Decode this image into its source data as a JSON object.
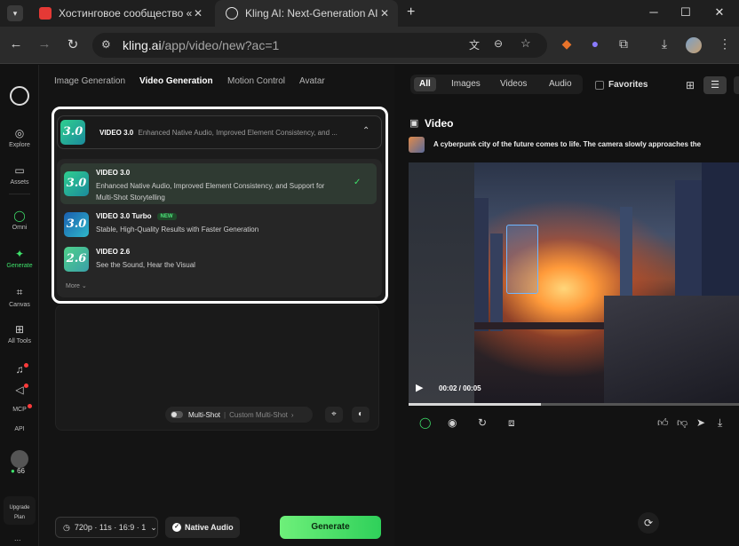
{
  "browser": {
    "tabs": [
      {
        "title": "Хостинговое сообщество «Tim",
        "favicon_color": "#e53935",
        "active": false
      },
      {
        "title": "Kling AI: Next-Generation AI Cr",
        "favicon_color": "#e6e6e6",
        "active": true
      }
    ],
    "new_tab_symbol": "+",
    "url_host": "kling.ai",
    "url_path": "/app/video/new?ac=1",
    "window_controls": [
      "minimize",
      "maximize",
      "close"
    ]
  },
  "left_rail": {
    "items": [
      {
        "label": "Explore",
        "icon": "compass-icon"
      },
      {
        "label": "Assets",
        "icon": "folder-icon"
      },
      {
        "label": "Omni",
        "icon": "ring-icon"
      },
      {
        "label": "Generate",
        "icon": "sparkle-icon",
        "active": true
      },
      {
        "label": "Canvas",
        "icon": "canvas-icon"
      },
      {
        "label": "All Tools",
        "icon": "grid-icon"
      },
      {
        "label": "MCP",
        "icon": "plug-icon"
      },
      {
        "label": "API",
        "icon": "api-icon"
      }
    ],
    "credits": "66",
    "upgrade_line1": "Upgrade",
    "upgrade_line2": "Plan",
    "more": "..."
  },
  "mode_tabs": [
    "Image Generation",
    "Video Generation",
    "Motion Control",
    "Avatar"
  ],
  "active_mode": "Video Generation",
  "model_select": {
    "selected_name": "VIDEO 3.0",
    "selected_desc": "Enhanced Native Audio, Improved Element Consistency, and ...",
    "options": [
      {
        "badge": "3.0",
        "name": "VIDEO 3.0",
        "desc": "Enhanced Native Audio, Improved Element Consistency, and Support for Multi-Shot Storytelling",
        "selected": true
      },
      {
        "badge": "3.0",
        "name": "VIDEO 3.0 Turbo",
        "tag": "NEW",
        "desc": "Stable, High-Quality Results with Faster Generation"
      },
      {
        "badge": "2.6",
        "name": "VIDEO 2.6",
        "desc": "See the Sound, Hear the Visual"
      }
    ],
    "more_label": "More"
  },
  "prompt_controls": {
    "multi_shot_label": "Multi-Shot",
    "custom_multi_shot": "Custom Multi-Shot"
  },
  "bottom_bar": {
    "settings": "720p · 11s · 16:9 · 1",
    "native_audio": "Native Audio",
    "generate": "Generate"
  },
  "results": {
    "filters": [
      "All",
      "Images",
      "Videos",
      "Audio"
    ],
    "active_filter": "All",
    "favorites_label": "Favorites",
    "section_title": "Video",
    "prompt_text": "A cyberpunk city of the future comes to life. The camera slowly approaches the",
    "time": "00:02 / 00:05",
    "progress": 0.4
  },
  "colors": {
    "accent_green": "#3ee06a",
    "generate_green": "#4fe06f",
    "dropdown_outline": "#ffffff"
  }
}
